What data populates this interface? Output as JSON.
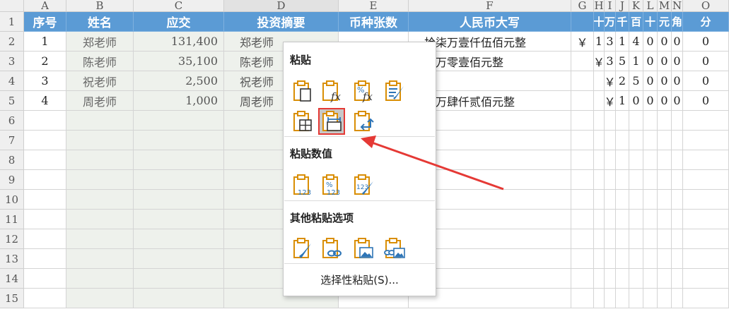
{
  "columns": [
    "A",
    "B",
    "C",
    "D",
    "E",
    "F",
    "G",
    "H",
    "I",
    "J",
    "K",
    "L",
    "M",
    "N",
    "O"
  ],
  "row_numbers": [
    "1",
    "2",
    "3",
    "4",
    "5",
    "6",
    "7",
    "8",
    "9",
    "10",
    "11",
    "12",
    "13",
    "14",
    "15"
  ],
  "headers": {
    "seq": "序号",
    "name": "姓名",
    "due": "应交",
    "summary": "投资摘要",
    "currency_count": "币种张数",
    "rmb_upper": "人民币大写",
    "digit_units": [
      "十",
      "万",
      "千",
      "百",
      "十",
      "元",
      "角",
      "分"
    ]
  },
  "rows": [
    {
      "seq": "1",
      "name": "郑老师",
      "amount": "131,400",
      "summary": "郑老师",
      "upper": "拾柒万壹仟伍佰元整",
      "g": "￥",
      "digits": [
        "",
        "1",
        "3",
        "1",
        "4",
        "0",
        "0",
        "0",
        "0"
      ]
    },
    {
      "seq": "2",
      "name": "陈老师",
      "amount": "35,100",
      "summary": "陈老师",
      "upper": "肆万零壹佰元整",
      "g": "",
      "digits": [
        "￥",
        "3",
        "5",
        "1",
        "0",
        "0",
        "0",
        "0"
      ]
    },
    {
      "seq": "3",
      "name": "祝老师",
      "amount": "2,500",
      "summary": "祝老师",
      "upper": "",
      "g": "",
      "digits": [
        "",
        "￥",
        "2",
        "5",
        "0",
        "0",
        "0",
        "0"
      ]
    },
    {
      "seq": "4",
      "name": "周老师",
      "amount": "1,000",
      "summary": "周老师",
      "upper": "叁万肆仟贰佰元整",
      "g": "",
      "digits": [
        "",
        "￥",
        "1",
        "0",
        "0",
        "0",
        "0",
        "0"
      ]
    }
  ],
  "context_menu": {
    "paste_title": "粘贴",
    "paste_values_title": "粘贴数值",
    "other_title": "其他粘贴选项",
    "paste_special": "选择性粘贴(S)...",
    "paste_icons": [
      "paste-icon",
      "paste-formulas-icon",
      "paste-formulas-number-format-icon",
      "keep-source-formatting-icon",
      "no-borders-icon",
      "keep-column-widths-icon",
      "transpose-icon"
    ],
    "value_icons": [
      "paste-values-icon",
      "values-number-format-icon",
      "values-source-formatting-icon"
    ],
    "other_icons": [
      "formatting-icon",
      "paste-link-icon",
      "picture-icon",
      "linked-picture-icon"
    ]
  },
  "colors": {
    "header_blue": "#5b9bd5",
    "highlight_red": "#e53935",
    "icon_orange": "#d98e04",
    "icon_blue": "#2e75b6"
  }
}
